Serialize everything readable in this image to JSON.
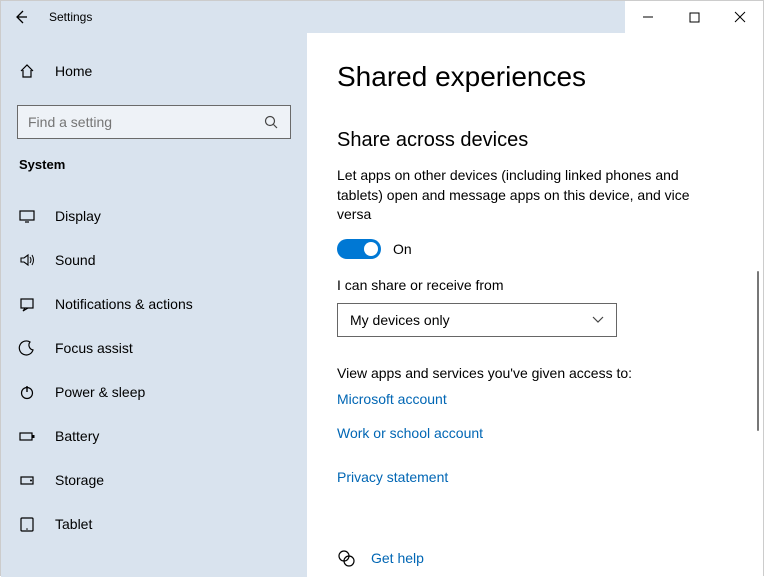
{
  "window": {
    "title": "Settings"
  },
  "sidebar": {
    "home": "Home",
    "search_placeholder": "Find a setting",
    "section": "System",
    "items": [
      {
        "label": "Display"
      },
      {
        "label": "Sound"
      },
      {
        "label": "Notifications & actions"
      },
      {
        "label": "Focus assist"
      },
      {
        "label": "Power & sleep"
      },
      {
        "label": "Battery"
      },
      {
        "label": "Storage"
      },
      {
        "label": "Tablet"
      }
    ]
  },
  "main": {
    "title": "Shared experiences",
    "subtitle": "Share across devices",
    "description": "Let apps on other devices (including linked phones and tablets) open and message apps on this device, and vice versa",
    "toggle_state": "On",
    "share_label": "I can share or receive from",
    "dropdown_value": "My devices only",
    "access_text": "View apps and services you've given access to:",
    "links": {
      "ms_account": "Microsoft account",
      "work_account": "Work or school account",
      "privacy": "Privacy statement"
    },
    "help": "Get help"
  }
}
